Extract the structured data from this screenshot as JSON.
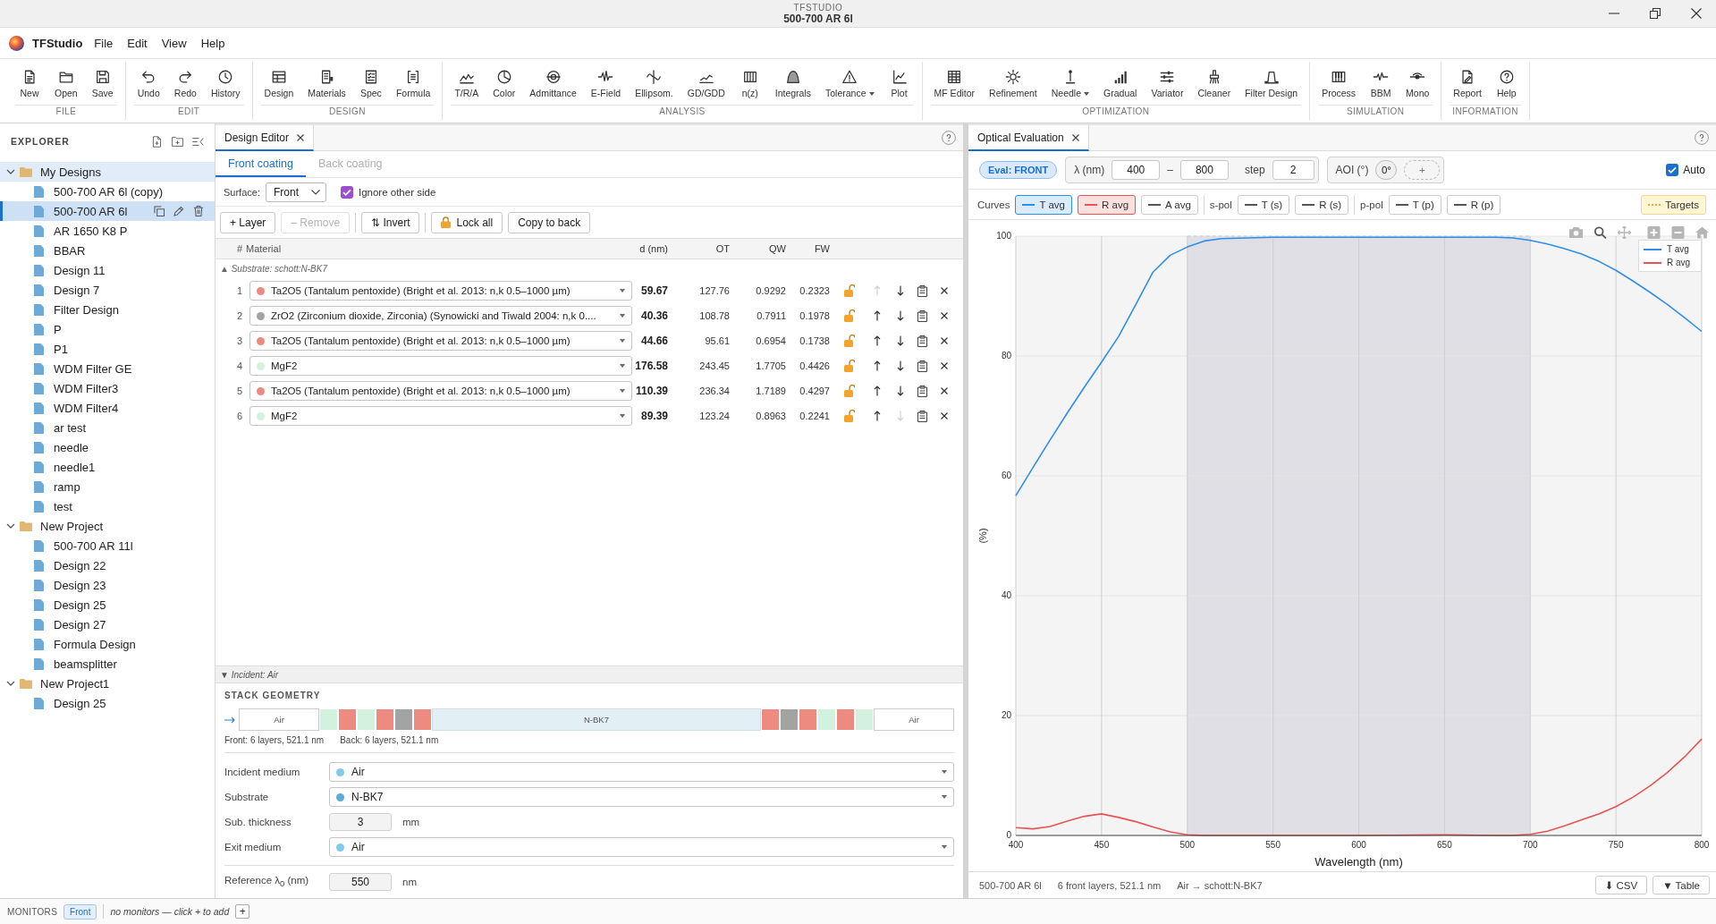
{
  "window": {
    "app": "TFSTUDIO",
    "title": "500-700 AR 6l"
  },
  "menu": {
    "brand": "TFStudio",
    "items": [
      "File",
      "Edit",
      "View",
      "Help"
    ]
  },
  "toolbar": [
    {
      "group": "FILE",
      "buttons": [
        {
          "label": "New",
          "dropdown": false
        },
        {
          "label": "Open",
          "dropdown": false
        },
        {
          "label": "Save",
          "dropdown": false
        }
      ]
    },
    {
      "group": "EDIT",
      "buttons": [
        {
          "label": "Undo",
          "dropdown": false
        },
        {
          "label": "Redo",
          "dropdown": false
        },
        {
          "label": "History",
          "dropdown": false
        }
      ]
    },
    {
      "group": "DESIGN",
      "buttons": [
        {
          "label": "Design",
          "dropdown": false
        },
        {
          "label": "Materials",
          "dropdown": false
        },
        {
          "label": "Spec",
          "dropdown": false
        },
        {
          "label": "Formula",
          "dropdown": false
        }
      ]
    },
    {
      "group": "ANALYSIS",
      "buttons": [
        {
          "label": "T/R/A",
          "dropdown": false
        },
        {
          "label": "Color",
          "dropdown": false
        },
        {
          "label": "Admittance",
          "dropdown": false
        },
        {
          "label": "E-Field",
          "dropdown": false
        },
        {
          "label": "Ellipsom.",
          "dropdown": false
        },
        {
          "label": "GD/GDD",
          "dropdown": false
        },
        {
          "label": "n(z)",
          "dropdown": false
        },
        {
          "label": "Integrals",
          "dropdown": false
        },
        {
          "label": "Tolerance",
          "dropdown": true
        },
        {
          "label": "Plot",
          "dropdown": false
        }
      ]
    },
    {
      "group": "OPTIMIZATION",
      "buttons": [
        {
          "label": "MF Editor",
          "dropdown": false
        },
        {
          "label": "Refinement",
          "dropdown": false
        },
        {
          "label": "Needle",
          "dropdown": true
        },
        {
          "label": "Gradual",
          "dropdown": false
        },
        {
          "label": "Variator",
          "dropdown": false
        },
        {
          "label": "Cleaner",
          "dropdown": false
        },
        {
          "label": "Filter Design",
          "dropdown": false
        }
      ]
    },
    {
      "group": "SIMULATION",
      "buttons": [
        {
          "label": "Process",
          "dropdown": false
        },
        {
          "label": "BBM",
          "dropdown": false
        },
        {
          "label": "Mono",
          "dropdown": false
        }
      ]
    },
    {
      "group": "INFORMATION",
      "buttons": [
        {
          "label": "Report",
          "dropdown": false
        },
        {
          "label": "Help",
          "dropdown": false
        }
      ]
    }
  ],
  "explorer": {
    "title": "EXPLORER",
    "tree": [
      {
        "kind": "folder",
        "label": "My Designs",
        "expanded": true,
        "active": true,
        "children": [
          {
            "kind": "design",
            "label": "500-700 AR 6l (copy)",
            "selected": false
          },
          {
            "kind": "design",
            "label": "500-700 AR 6l",
            "selected": true
          },
          {
            "kind": "design",
            "label": "AR 1650 K8 P",
            "selected": false
          },
          {
            "kind": "design",
            "label": "BBAR",
            "selected": false
          },
          {
            "kind": "design",
            "label": "Design 11",
            "selected": false
          },
          {
            "kind": "design",
            "label": "Design 7",
            "selected": false
          },
          {
            "kind": "design",
            "label": "Filter Design",
            "selected": false
          },
          {
            "kind": "design",
            "label": "P",
            "selected": false
          },
          {
            "kind": "design",
            "label": "P1",
            "selected": false
          },
          {
            "kind": "design",
            "label": "WDM Filter GE",
            "selected": false
          },
          {
            "kind": "design",
            "label": "WDM Filter3",
            "selected": false
          },
          {
            "kind": "design",
            "label": "WDM Filter4",
            "selected": false
          },
          {
            "kind": "design",
            "label": "ar test",
            "selected": false
          },
          {
            "kind": "design",
            "label": "needle",
            "selected": false
          },
          {
            "kind": "design",
            "label": "needle1",
            "selected": false
          },
          {
            "kind": "design",
            "label": "ramp",
            "selected": false
          },
          {
            "kind": "design",
            "label": "test",
            "selected": false
          }
        ]
      },
      {
        "kind": "folder",
        "label": "New Project",
        "expanded": true,
        "active": false,
        "children": [
          {
            "kind": "design",
            "label": "500-700 AR 11l",
            "selected": false
          },
          {
            "kind": "design",
            "label": "Design 22",
            "selected": false
          },
          {
            "kind": "design",
            "label": "Design 23",
            "selected": false
          },
          {
            "kind": "design",
            "label": "Design 25",
            "selected": false
          },
          {
            "kind": "design",
            "label": "Design 27",
            "selected": false
          },
          {
            "kind": "design",
            "label": "Formula Design",
            "selected": false
          },
          {
            "kind": "design",
            "label": "beamsplitter",
            "selected": false
          }
        ]
      },
      {
        "kind": "folder",
        "label": "New Project1",
        "expanded": true,
        "active": false,
        "children": [
          {
            "kind": "design",
            "label": "Design 25",
            "selected": false
          }
        ]
      }
    ]
  },
  "design_editor": {
    "tab": {
      "label": "Design Editor",
      "selected": true
    },
    "subtabs": [
      {
        "label": "Front coating",
        "selected": true
      },
      {
        "label": "Back coating",
        "selected": false
      }
    ],
    "surface": {
      "label": "Surface:",
      "value": "Front"
    },
    "ignore_other_side": {
      "label": "Ignore other side",
      "checked": true
    },
    "action_groups": [
      [
        {
          "label": "+ Layer",
          "kind": "text",
          "disabled": false
        },
        {
          "label": "– Remove",
          "kind": "text",
          "disabled": true
        }
      ],
      [
        {
          "label": "⇅ Invert",
          "kind": "text",
          "disabled": false
        }
      ],
      [
        {
          "label": "Lock all",
          "kind": "lock",
          "disabled": false
        },
        {
          "label": "Copy to back",
          "kind": "text",
          "disabled": false
        }
      ]
    ],
    "columns": [
      "#",
      "Material",
      "d (nm)",
      "OT",
      "QW",
      "FW"
    ],
    "substrate_row": "▲ Substrate: schott:N-BK7",
    "layers": [
      {
        "index": "1",
        "material": "Ta2O5 (Tantalum pentoxide) (Bright et al. 2013: n,k 0.5–1000 µm)",
        "color": "#ee8b80",
        "d": "59.67",
        "ot": "127.76",
        "qw": "0.9292",
        "fw": "0.2323",
        "locked": false,
        "can_move_up": false,
        "can_move_down": true
      },
      {
        "index": "2",
        "material": "ZrO2 (Zirconium dioxide, Zirconia) (Synowicki and Tiwald 2004: n,k 0....",
        "color": "#a3a3a3",
        "d": "40.36",
        "ot": "108.78",
        "qw": "0.7911",
        "fw": "0.1978",
        "locked": false,
        "can_move_up": true,
        "can_move_down": true
      },
      {
        "index": "3",
        "material": "Ta2O5 (Tantalum pentoxide) (Bright et al. 2013: n,k 0.5–1000 µm)",
        "color": "#ee8b80",
        "d": "44.66",
        "ot": "95.61",
        "qw": "0.6954",
        "fw": "0.1738",
        "locked": false,
        "can_move_up": true,
        "can_move_down": true
      },
      {
        "index": "4",
        "material": "MgF2",
        "color": "#d3f1df",
        "d": "176.58",
        "ot": "243.45",
        "qw": "1.7705",
        "fw": "0.4426",
        "locked": false,
        "can_move_up": true,
        "can_move_down": true
      },
      {
        "index": "5",
        "material": "Ta2O5 (Tantalum pentoxide) (Bright et al. 2013: n,k 0.5–1000 µm)",
        "color": "#ee8b80",
        "d": "110.39",
        "ot": "236.34",
        "qw": "1.7189",
        "fw": "0.4297",
        "locked": false,
        "can_move_up": true,
        "can_move_down": true
      },
      {
        "index": "6",
        "material": "MgF2",
        "color": "#d3f1df",
        "d": "89.39",
        "ot": "123.24",
        "qw": "0.8963",
        "fw": "0.2241",
        "locked": false,
        "can_move_up": true,
        "can_move_down": false
      }
    ],
    "incident_header": "▼ Incident: Air",
    "stack": {
      "title": "STACK GEOMETRY",
      "incident": "Air",
      "substrate": "N-BK7",
      "exit": "Air",
      "front_layers": [
        {
          "color": "#d3f1df"
        },
        {
          "color": "#ee8b80"
        },
        {
          "color": "#d3f1df"
        },
        {
          "color": "#ee8b80"
        },
        {
          "color": "#a3a3a3"
        },
        {
          "color": "#ee8b80"
        }
      ],
      "back_layers": [
        {
          "color": "#ee8b80"
        },
        {
          "color": "#a3a3a3"
        },
        {
          "color": "#ee8b80"
        },
        {
          "color": "#d3f1df"
        },
        {
          "color": "#ee8b80"
        },
        {
          "color": "#d3f1df"
        }
      ],
      "front_caption": "Front: 6 layers, 521.1 nm",
      "back_caption": "Back: 6 layers, 521.1 nm"
    },
    "media": [
      {
        "label": "Incident medium",
        "kind": "select",
        "value": "Air",
        "color": "#84c8ea"
      },
      {
        "label": "Substrate",
        "kind": "select",
        "value": "N-BK7",
        "color": "#5ea9d6"
      },
      {
        "label": "Sub. thickness",
        "kind": "number",
        "value": "3",
        "unit": "mm"
      },
      {
        "label": "Exit medium",
        "kind": "select",
        "value": "Air",
        "color": "#84c8ea"
      }
    ],
    "reference": {
      "label": "Reference λ$_{0}$ (nm)",
      "value": "550",
      "unit": "nm"
    }
  },
  "monitors": {
    "title": "MONITORS",
    "badge": "Front",
    "hint": "no monitors — click + to add",
    "add": "+"
  },
  "evaluation": {
    "tab": {
      "label": "Optical Evaluation",
      "selected": true
    },
    "eval_badge": "Eval: FRONT",
    "wavelength": {
      "label": "λ (nm)",
      "from": "400",
      "dash": "–",
      "to": "800",
      "step_label": "step",
      "step": "2"
    },
    "aoi": {
      "label": "AOI (°)",
      "angles": [
        "0°"
      ],
      "add": "+"
    },
    "auto": {
      "label": "Auto",
      "checked": true
    },
    "curve_groups": [
      {
        "label": "Curves",
        "items": [
          {
            "label": "T avg",
            "on": true,
            "color": "#2f8fe8"
          },
          {
            "label": "R avg",
            "on": true,
            "color": "#e85454"
          },
          {
            "label": "A avg",
            "on": false,
            "color": "#555555"
          }
        ]
      },
      {
        "label": "s-pol",
        "items": [
          {
            "label": "T (s)",
            "on": false,
            "color": "#555555"
          },
          {
            "label": "R (s)",
            "on": false,
            "color": "#555555"
          }
        ]
      },
      {
        "label": "p-pol",
        "items": [
          {
            "label": "T (p)",
            "on": false,
            "color": "#555555"
          },
          {
            "label": "R (p)",
            "on": false,
            "color": "#555555"
          }
        ]
      }
    ],
    "targets": {
      "label": "Targets",
      "on": true
    },
    "chart_data": {
      "type": "line",
      "xlabel": "Wavelength (nm)",
      "ylabel": "(%)",
      "x": [
        400,
        410,
        420,
        430,
        440,
        450,
        460,
        470,
        480,
        490,
        500,
        510,
        520,
        550,
        600,
        650,
        680,
        690,
        700,
        710,
        720,
        730,
        740,
        750,
        760,
        770,
        780,
        790,
        800
      ],
      "series": [
        {
          "name": "T avg",
          "color": "#2f8fe8",
          "values": [
            56.7,
            61.4,
            66.0,
            70.5,
            74.8,
            79.0,
            83.3,
            88.6,
            94.0,
            96.8,
            98.2,
            99.2,
            99.6,
            99.8,
            99.8,
            99.8,
            99.8,
            99.7,
            99.3,
            98.7,
            97.9,
            97.0,
            95.8,
            94.3,
            92.5,
            90.6,
            88.6,
            86.4,
            84.1
          ]
        },
        {
          "name": "R avg",
          "color": "#e85454",
          "values": [
            1.3,
            1.1,
            1.5,
            2.4,
            3.2,
            3.6,
            3.0,
            2.3,
            1.4,
            0.6,
            0.1,
            0.0,
            0.0,
            0.0,
            0.0,
            0.1,
            0.0,
            0.0,
            0.2,
            0.7,
            1.6,
            2.6,
            3.6,
            4.8,
            6.4,
            8.3,
            10.5,
            13.1,
            16.1
          ]
        }
      ],
      "xlim": [
        400,
        800
      ],
      "ylim": [
        0,
        100
      ],
      "xticks": [
        400,
        450,
        500,
        550,
        600,
        650,
        700,
        750,
        800
      ],
      "yticks": [
        0,
        20,
        40,
        60,
        80,
        100
      ],
      "grid": true,
      "bands": [
        {
          "axis": "x",
          "from": 500,
          "to": 700
        }
      ]
    },
    "status": [
      "500-700 AR 6l",
      "6 front layers, 521.1 nm",
      "Air → schott:N-BK7"
    ],
    "buttons": [
      "⬇ CSV",
      "▼ Table"
    ]
  }
}
